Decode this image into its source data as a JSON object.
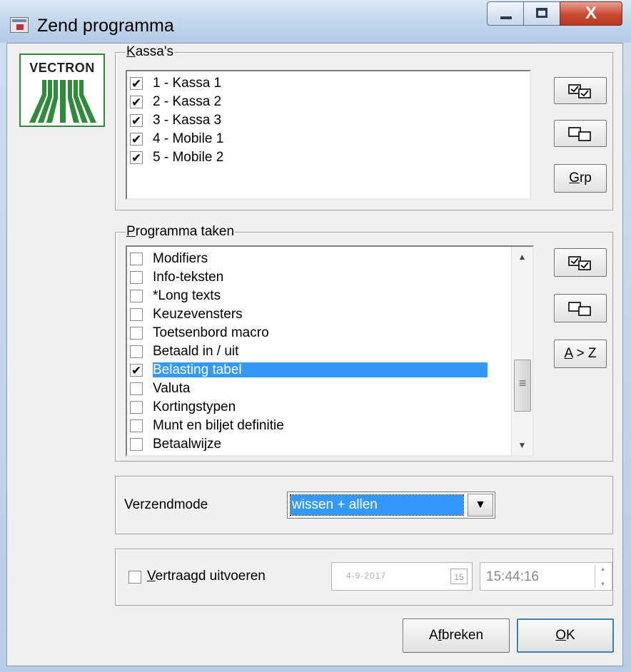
{
  "window": {
    "title": "Zend programma",
    "close_glyph": "X"
  },
  "logo": {
    "text": "VECTRON",
    "brand_color": "#2f8a3a"
  },
  "kassas": {
    "group_label": "Kassa's",
    "items": [
      {
        "label": "1 - Kassa 1",
        "checked": true
      },
      {
        "label": "2 - Kassa 2",
        "checked": true
      },
      {
        "label": "3 - Kassa 3",
        "checked": true
      },
      {
        "label": "4 - Mobile 1",
        "checked": true
      },
      {
        "label": "5 - Mobile 2",
        "checked": true
      }
    ],
    "buttons": {
      "select_all_icon": "check-all-icon",
      "deselect_all_icon": "uncheck-all-icon",
      "group_label": "Grp"
    }
  },
  "taken": {
    "group_label": "Programma taken",
    "items": [
      {
        "label": "Modifiers",
        "checked": false
      },
      {
        "label": "Info-teksten",
        "checked": false
      },
      {
        "label": "*Long texts",
        "checked": false
      },
      {
        "label": "Keuzevensters",
        "checked": false
      },
      {
        "label": "Toetsenbord macro",
        "checked": false
      },
      {
        "label": "Betaald  in / uit",
        "checked": false
      },
      {
        "label": "Belasting  tabel",
        "checked": true,
        "selected": true
      },
      {
        "label": "Valuta",
        "checked": false
      },
      {
        "label": "Kortingstypen",
        "checked": false
      },
      {
        "label": "Munt en biljet definitie",
        "checked": false
      },
      {
        "label": "Betaalwijze",
        "checked": false
      }
    ],
    "buttons": {
      "select_all_icon": "check-all-icon",
      "deselect_all_icon": "uncheck-all-icon",
      "sort_label": "A > Z"
    }
  },
  "verzend": {
    "label": "Verzendmode",
    "value": "wissen + allen",
    "accent_color": "#3399ff"
  },
  "delay": {
    "label": "Vertraagd uitvoeren",
    "checked": false,
    "date_value": "4-9-2017",
    "calendar_icon_text": "15",
    "time_value": "15:44:16"
  },
  "footer": {
    "cancel_label": "Afbreken",
    "ok_label": "OK"
  }
}
